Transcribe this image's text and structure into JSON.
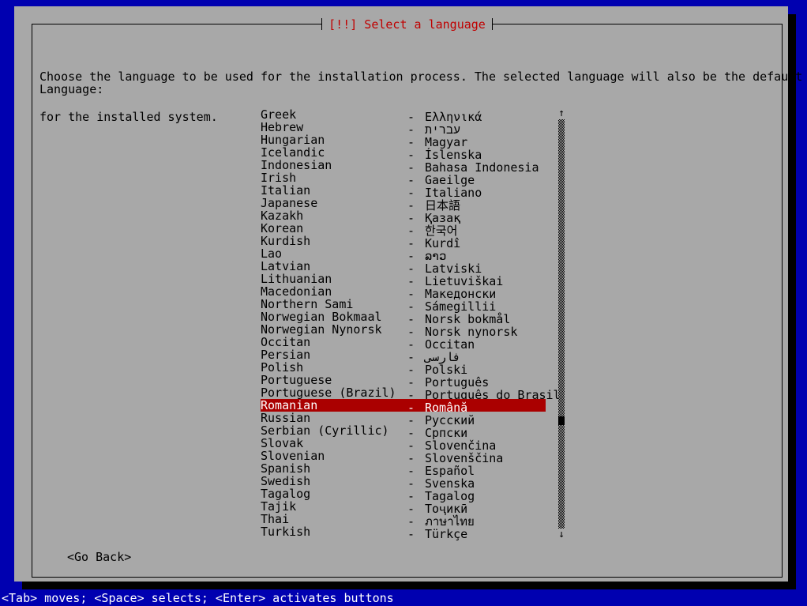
{
  "colors": {
    "desktop_blue": "#0000b0",
    "panel_gray": "#a8a8a8",
    "title_red": "#c00000",
    "highlight_red": "#aa0000",
    "text_black": "#000000",
    "text_white": "#ffffff",
    "shadow_black": "#000000"
  },
  "window": {
    "title": "[!!] Select a language"
  },
  "intro": {
    "line1": "Choose the language to be used for the installation process. The selected language will also be the default language",
    "line2": "for the installed system."
  },
  "form": {
    "language_label": "Language:"
  },
  "list": {
    "separator": "-",
    "selected_index": 23,
    "items": [
      {
        "english": "Greek",
        "native": "Ελληνικά"
      },
      {
        "english": "Hebrew",
        "native": "עברית"
      },
      {
        "english": "Hungarian",
        "native": "Magyar"
      },
      {
        "english": "Icelandic",
        "native": "Íslenska"
      },
      {
        "english": "Indonesian",
        "native": "Bahasa Indonesia"
      },
      {
        "english": "Irish",
        "native": "Gaeilge"
      },
      {
        "english": "Italian",
        "native": "Italiano"
      },
      {
        "english": "Japanese",
        "native": "日本語"
      },
      {
        "english": "Kazakh",
        "native": "Қазақ"
      },
      {
        "english": "Korean",
        "native": "한국어"
      },
      {
        "english": "Kurdish",
        "native": "Kurdî"
      },
      {
        "english": "Lao",
        "native": "ລາວ"
      },
      {
        "english": "Latvian",
        "native": "Latviski"
      },
      {
        "english": "Lithuanian",
        "native": "Lietuviškai"
      },
      {
        "english": "Macedonian",
        "native": "Македонски"
      },
      {
        "english": "Northern Sami",
        "native": "Sámegillii"
      },
      {
        "english": "Norwegian Bokmaal",
        "native": "Norsk bokmål"
      },
      {
        "english": "Norwegian Nynorsk",
        "native": "Norsk nynorsk"
      },
      {
        "english": "Occitan",
        "native": "Occitan"
      },
      {
        "english": "Persian",
        "native": "فارسی"
      },
      {
        "english": "Polish",
        "native": "Polski"
      },
      {
        "english": "Portuguese",
        "native": "Português"
      },
      {
        "english": "Portuguese (Brazil)",
        "native": "Português do Brasil"
      },
      {
        "english": "Romanian",
        "native": "Română"
      },
      {
        "english": "Russian",
        "native": "Русский"
      },
      {
        "english": "Serbian (Cyrillic)",
        "native": "Српски"
      },
      {
        "english": "Slovak",
        "native": "Slovenčina"
      },
      {
        "english": "Slovenian",
        "native": "Slovenščina"
      },
      {
        "english": "Spanish",
        "native": "Español"
      },
      {
        "english": "Swedish",
        "native": "Svenska"
      },
      {
        "english": "Tagalog",
        "native": "Tagalog"
      },
      {
        "english": "Tajik",
        "native": "Тоҷикӣ"
      },
      {
        "english": "Thai",
        "native": "ภาษาไทย"
      },
      {
        "english": "Turkish",
        "native": "Türkçe"
      }
    ]
  },
  "scrollbar": {
    "up_arrow": "↑",
    "down_arrow": "↓"
  },
  "buttons": {
    "go_back": "<Go Back>"
  },
  "statusbar": {
    "hint": "<Tab> moves; <Space> selects; <Enter> activates buttons"
  }
}
